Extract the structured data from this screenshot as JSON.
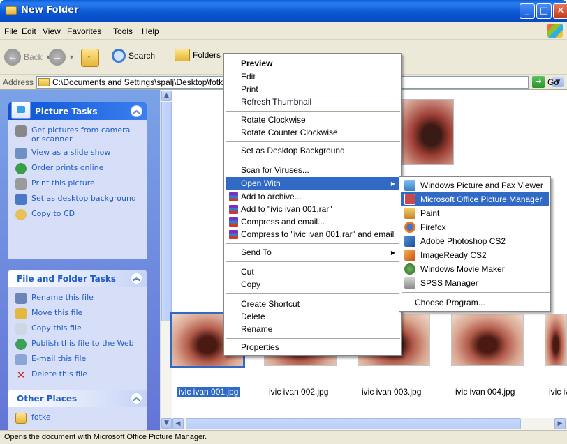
{
  "window": {
    "title": "New Folder"
  },
  "menubar": {
    "items": [
      "File",
      "Edit",
      "View",
      "Favorites",
      "Tools",
      "Help"
    ]
  },
  "toolbar": {
    "back": "Back",
    "search": "Search",
    "folders": "Folders"
  },
  "address": {
    "label": "Address",
    "path": "C:\\Documents and Settings\\spalj\\Desktop\\fotke",
    "go": "Go"
  },
  "picture_tasks": {
    "title": "Picture Tasks",
    "items": [
      "Get pictures from camera or scanner",
      "View as a slide show",
      "Order prints online",
      "Print this picture",
      "Set as desktop background",
      "Copy to CD"
    ]
  },
  "file_tasks": {
    "title": "File and Folder Tasks",
    "items": [
      "Rename this file",
      "Move this file",
      "Copy this file",
      "Publish this file to the Web",
      "E-mail this file",
      "Delete this file"
    ]
  },
  "other_places": {
    "title": "Other Places",
    "items": [
      "fotke"
    ]
  },
  "thumbnails": [
    "ivic ivan 001.jpg",
    "ivic ivan 002.jpg",
    "ivic ivan 003.jpg",
    "ivic ivan 004.jpg",
    "ivic iv"
  ],
  "context_menu": {
    "items": [
      "Preview",
      "Edit",
      "Print",
      "Refresh Thumbnail",
      "Rotate Clockwise",
      "Rotate Counter Clockwise",
      "Set as Desktop Background",
      "Scan for Viruses...",
      "Open With",
      "Add to archive...",
      "Add to \"ivic ivan 001.rar\"",
      "Compress and email...",
      "Compress to \"ivic ivan 001.rar\" and email",
      "Send To",
      "Cut",
      "Copy",
      "Create Shortcut",
      "Delete",
      "Rename",
      "Properties"
    ]
  },
  "open_with_menu": {
    "items": [
      "Windows Picture and Fax Viewer",
      "Microsoft Office Picture Manager",
      "Paint",
      "Firefox",
      "Adobe Photoshop CS2",
      "ImageReady CS2",
      "Windows Movie Maker",
      "SPSS Manager",
      "Choose Program..."
    ]
  },
  "status": {
    "text": "Opens the document with Microsoft Office Picture Manager."
  },
  "colors": {
    "selection": "#316ac5",
    "task_link": "#215dc6",
    "panel_bg": "#6375d6"
  }
}
